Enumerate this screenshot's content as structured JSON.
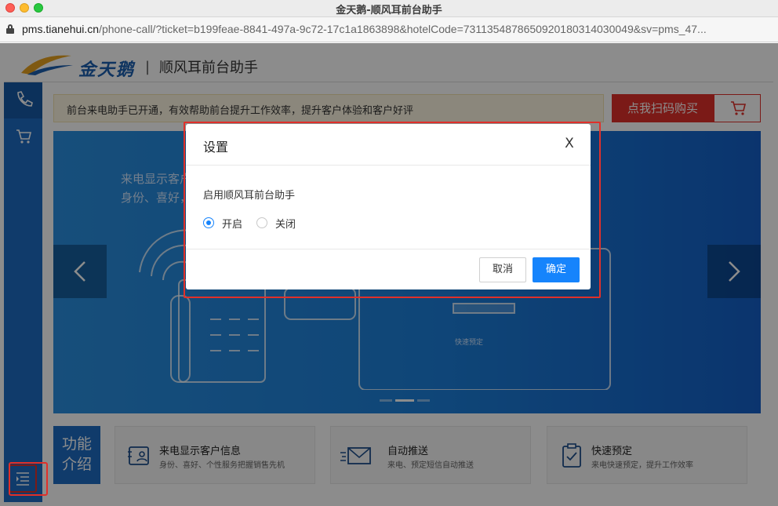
{
  "window": {
    "title": "金天鹅-顺风耳前台助手"
  },
  "address_bar": {
    "host": "pms.tianehui.cn",
    "path": "/phone-call/?ticket=b199feae-8841-497a-9c72-17c1a1863898&hotelCode=7311354878650920180314030049&sv=pms_47..."
  },
  "header": {
    "brand": "金天鹅",
    "separator": "|",
    "subtitle": "顺风耳前台助手"
  },
  "notice": {
    "text": "前台来电助手已开通，有效帮助前台提升工作效率，提升客户体验和客户好评"
  },
  "buy_button": {
    "label": "点我扫码购买"
  },
  "banner": {
    "line1": "来电显示客户",
    "line2": "身份、喜好，",
    "screen_button": "快速预定"
  },
  "features": {
    "tag_line1": "功能",
    "tag_line2": "介绍",
    "items": [
      {
        "title": "来电显示客户信息",
        "desc": "身份、喜好、个性服务把握销售先机",
        "icon": "contact-card-icon"
      },
      {
        "title": "自动推送",
        "desc": "来电、预定短信自动推送",
        "icon": "envelope-icon"
      },
      {
        "title": "快速预定",
        "desc": "来电快速预定，提升工作效率",
        "icon": "clipboard-check-icon"
      }
    ]
  },
  "modal": {
    "title": "设置",
    "close_symbol": "X",
    "field_label": "启用顺风耳前台助手",
    "options": [
      {
        "label": "开启",
        "checked": true
      },
      {
        "label": "关闭",
        "checked": false
      }
    ],
    "cancel_label": "取消",
    "ok_label": "确定"
  },
  "colors": {
    "primary": "#1684fc",
    "sidebar": "#1e6cc4",
    "buy": "#e0302a",
    "highlight_outline": "#e0302a"
  }
}
